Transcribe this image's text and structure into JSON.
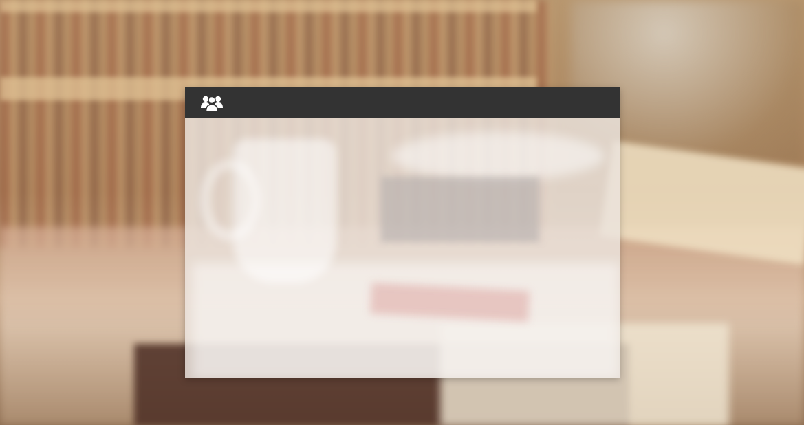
{
  "window": {
    "title": "",
    "header_icon": "users-group-icon",
    "header_background": "#333333",
    "icon_color": "#ffffff"
  },
  "body": {
    "content": ""
  }
}
